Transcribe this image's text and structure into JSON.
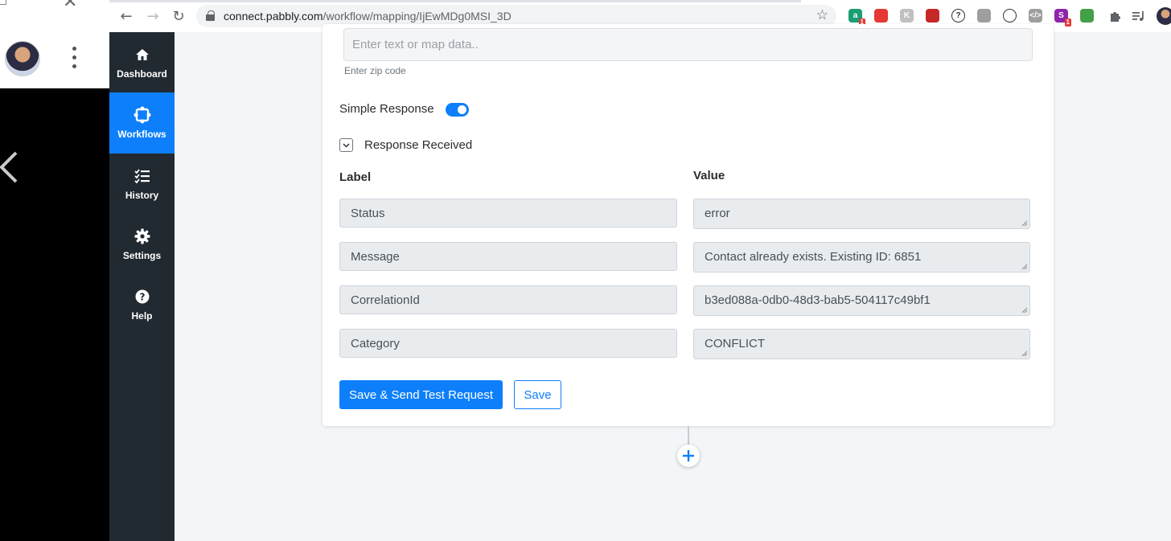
{
  "browser": {
    "url_host": "connect.pabbly.com",
    "url_path": "/workflow/mapping/IjEwMDg0MSI_3D",
    "extensions": [
      {
        "name": "grammar-ext",
        "color": "#1a9e74",
        "glyph": "a",
        "badge": "1"
      },
      {
        "name": "shop-ext",
        "color": "#e53935",
        "glyph": "",
        "badge": ""
      },
      {
        "name": "k-ext",
        "color": "#c0c0c0",
        "glyph": "K",
        "badge": ""
      },
      {
        "name": "bookmark-ext",
        "color": "#c62828",
        "glyph": "",
        "badge": ""
      },
      {
        "name": "help-ext",
        "color": "#ffffff",
        "glyph": "?",
        "badge": ""
      },
      {
        "name": "compass-ext",
        "color": "#9e9e9e",
        "glyph": "",
        "badge": ""
      },
      {
        "name": "check-ext",
        "color": "#ffffff",
        "glyph": "",
        "badge": ""
      },
      {
        "name": "code-ext",
        "color": "#9e9e9e",
        "glyph": "</>",
        "badge": ""
      },
      {
        "name": "s-ext",
        "color": "#8e24aa",
        "glyph": "S",
        "badge": "1"
      },
      {
        "name": "color-ext",
        "color": "#43a047",
        "glyph": "",
        "badge": ""
      }
    ]
  },
  "sidebar": {
    "items": [
      {
        "label": "Dashboard",
        "icon": "home-icon"
      },
      {
        "label": "Workflows",
        "icon": "workflow-icon"
      },
      {
        "label": "History",
        "icon": "checklist-icon"
      },
      {
        "label": "Settings",
        "icon": "gear-icon"
      },
      {
        "label": "Help",
        "icon": "question-icon"
      }
    ]
  },
  "form": {
    "zip_placeholder": "Enter text or map data..",
    "zip_help": "Enter zip code",
    "simple_response_label": "Simple Response",
    "simple_response_on": true,
    "response_received_label": "Response Received",
    "label_header": "Label",
    "value_header": "Value",
    "rows": [
      {
        "label": "Status",
        "value": "error"
      },
      {
        "label": "Message",
        "value": "Contact already exists. Existing ID: 6851"
      },
      {
        "label": "CorrelationId",
        "value": "b3ed088a-0db0-48d3-bab5-504117c49bf1"
      },
      {
        "label": "Category",
        "value": "CONFLICT"
      }
    ],
    "save_send_label": "Save & Send Test Request",
    "save_label": "Save"
  },
  "colors": {
    "accent": "#0d7ffb",
    "sidebar_bg": "#222a31"
  }
}
